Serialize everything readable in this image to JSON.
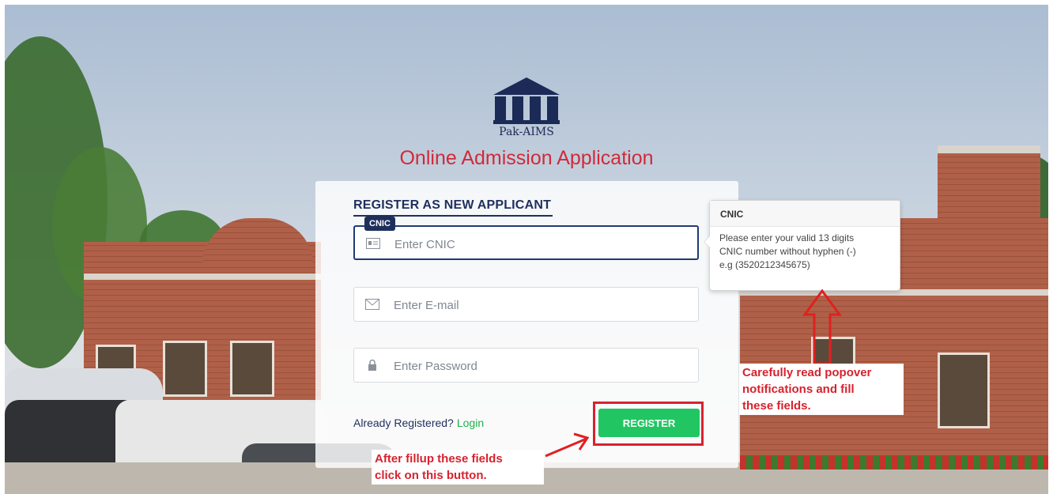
{
  "brand": {
    "logo_text": "Pak-AIMS",
    "title": "Online Admission Application"
  },
  "form": {
    "heading": "REGISTER AS NEW APPLICANT",
    "cnic_chip": "CNIC",
    "cnic_placeholder": "Enter CNIC",
    "email_placeholder": "Enter E-mail",
    "password_placeholder": "Enter Password",
    "already_registered": "Already Registered?",
    "login_link": "Login",
    "register_button": "REGISTER"
  },
  "popover": {
    "title": "CNIC",
    "body_line1": "Please enter your valid 13 digits",
    "body_line2": "CNIC number without hyphen (-)",
    "body_line3": "e.g (3520212345675)"
  },
  "annotations": {
    "popover_note_line1": "Carefully read popover",
    "popover_note_line2": "notifications and fill",
    "popover_note_line3": "these fields.",
    "button_note_line1": "After fillup these fields",
    "button_note_line2": "click on this button."
  },
  "icons": {
    "cnic": "id-card-icon",
    "email": "envelope-icon",
    "password": "lock-icon"
  },
  "colors": {
    "brand_navy": "#1f2f5c",
    "title_red": "#d02a3a",
    "register_green": "#21c663",
    "login_green": "#22b04b",
    "annotation_red": "#d7222e"
  }
}
